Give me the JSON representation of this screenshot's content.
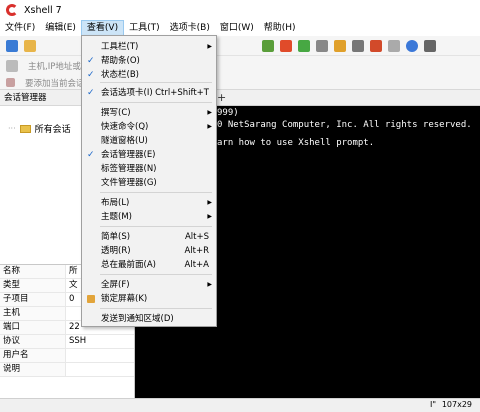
{
  "title": "Xshell 7",
  "menu": [
    "文件(F)",
    "编辑(E)",
    "查看(V)",
    "工具(T)",
    "选项卡(B)",
    "窗口(W)",
    "帮助(H)"
  ],
  "toolbar2_text": "主机,IP地址或会",
  "toolbar3_text": "要添加当前会话",
  "session_manager": {
    "header": "会话管理器",
    "all_sessions": "所有会话"
  },
  "properties": [
    {
      "k": "名称",
      "v": "所"
    },
    {
      "k": "类型",
      "v": "文"
    },
    {
      "k": "子项目",
      "v": "0"
    },
    {
      "k": "主机",
      "v": ""
    },
    {
      "k": "端口",
      "v": "22"
    },
    {
      "k": "协议",
      "v": "SSH"
    },
    {
      "k": "用户名",
      "v": ""
    },
    {
      "k": "说明",
      "v": ""
    }
  ],
  "tab_plus": "+",
  "terminal": {
    "line1": "999)",
    "line2": "0 NetSarang Computer, Inc. All rights reserved.",
    "line3": "arn how to use Xshell prompt."
  },
  "view_menu": {
    "items": [
      {
        "label": "工具栏(T)",
        "checked": false,
        "submenu": true,
        "shortcut": ""
      },
      {
        "label": "帮助条(O)",
        "checked": true,
        "submenu": false,
        "shortcut": ""
      },
      {
        "label": "状态栏(B)",
        "checked": true,
        "submenu": false,
        "shortcut": ""
      },
      {
        "label": "会话选项卡(I)",
        "checked": true,
        "submenu": false,
        "shortcut": "Ctrl+Shift+T"
      },
      {
        "label": "撰写(C)",
        "checked": false,
        "submenu": true,
        "shortcut": ""
      },
      {
        "label": "快速命令(Q)",
        "checked": false,
        "submenu": true,
        "shortcut": ""
      },
      {
        "label": "隧道窗格(U)",
        "checked": false,
        "submenu": false,
        "shortcut": ""
      },
      {
        "label": "会话管理器(E)",
        "checked": true,
        "submenu": false,
        "shortcut": ""
      },
      {
        "label": "标签管理器(N)",
        "checked": false,
        "submenu": false,
        "shortcut": ""
      },
      {
        "label": "文件管理器(G)",
        "checked": false,
        "submenu": false,
        "shortcut": ""
      },
      {
        "label": "布局(L)",
        "checked": false,
        "submenu": true,
        "shortcut": ""
      },
      {
        "label": "主题(M)",
        "checked": false,
        "submenu": true,
        "shortcut": ""
      },
      {
        "label": "简单(S)",
        "checked": false,
        "submenu": false,
        "shortcut": "Alt+S"
      },
      {
        "label": "透明(R)",
        "checked": false,
        "submenu": false,
        "shortcut": "Alt+R"
      },
      {
        "label": "总在最前面(A)",
        "checked": false,
        "submenu": false,
        "shortcut": "Alt+A"
      },
      {
        "label": "全屏(F)",
        "checked": false,
        "submenu": true,
        "shortcut": ""
      },
      {
        "label": "锁定屏幕(K)",
        "checked": false,
        "submenu": false,
        "shortcut": "",
        "lock": true
      },
      {
        "label": "发送到通知区域(D)",
        "checked": false,
        "submenu": false,
        "shortcut": ""
      }
    ]
  },
  "status": {
    "size": "107x29",
    "icon": "I\""
  }
}
